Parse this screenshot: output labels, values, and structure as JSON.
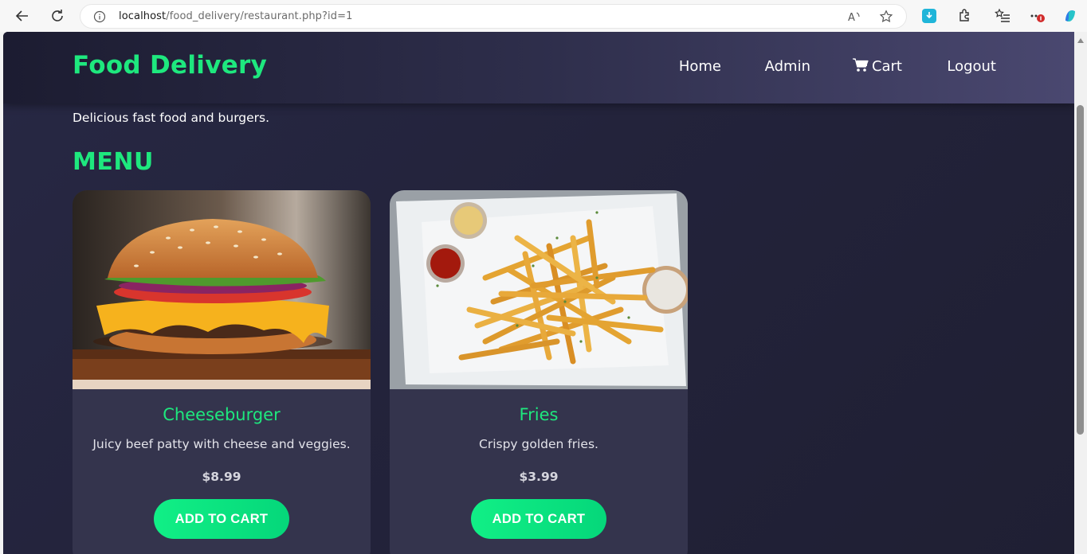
{
  "browser": {
    "url_host": "localhost",
    "url_path": "/food_delivery/restaurant.php?id=1"
  },
  "site": {
    "brand": "Food Delivery",
    "nav": {
      "home": "Home",
      "admin": "Admin",
      "cart": "Cart",
      "logout": "Logout"
    }
  },
  "restaurant": {
    "description": "Delicious fast food and burgers."
  },
  "menu": {
    "title": "MENU",
    "items": [
      {
        "name": "Cheeseburger",
        "description": "Juicy beef patty with cheese and veggies.",
        "price": "$8.99",
        "button": "ADD TO CART"
      },
      {
        "name": "Fries",
        "description": "Crispy golden fries.",
        "price": "$3.99",
        "button": "ADD TO CART"
      }
    ]
  },
  "colors": {
    "accent": "#1ee87e",
    "card_bg": "#34344d",
    "page_bg": "#23233b"
  }
}
